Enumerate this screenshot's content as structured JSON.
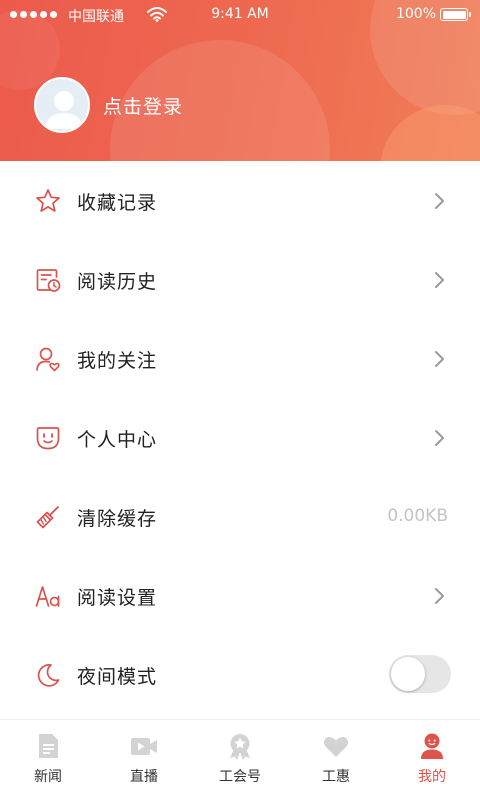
{
  "status_bar": {
    "carrier": "中国联通",
    "time": "9:41 AM",
    "battery": "100%"
  },
  "profile": {
    "login_label": "点击登录"
  },
  "menu": {
    "items": [
      {
        "label": "收藏记录",
        "icon": "star-icon"
      },
      {
        "label": "阅读历史",
        "icon": "reading-history-icon"
      },
      {
        "label": "我的关注",
        "icon": "follow-user-icon"
      },
      {
        "label": "个人中心",
        "icon": "profile-face-icon"
      },
      {
        "label": "清除缓存",
        "icon": "broom-icon",
        "value": "0.00KB"
      },
      {
        "label": "阅读设置",
        "icon": "font-size-icon"
      },
      {
        "label": "夜间模式",
        "icon": "moon-icon",
        "toggle_on": false
      }
    ]
  },
  "tabbar": {
    "tabs": [
      {
        "label": "新闻",
        "icon": "news-icon"
      },
      {
        "label": "直播",
        "icon": "video-icon"
      },
      {
        "label": "工会号",
        "icon": "badge-icon"
      },
      {
        "label": "工惠",
        "icon": "heart-icon"
      },
      {
        "label": "我的",
        "icon": "user-icon",
        "active": true
      }
    ]
  },
  "colors": {
    "accent": "#e0534a",
    "header_start": "#ec5a4c",
    "header_end": "#f07f59",
    "icon_stroke": "#d9534f",
    "tab_inactive_icon": "#d3d3d3"
  }
}
